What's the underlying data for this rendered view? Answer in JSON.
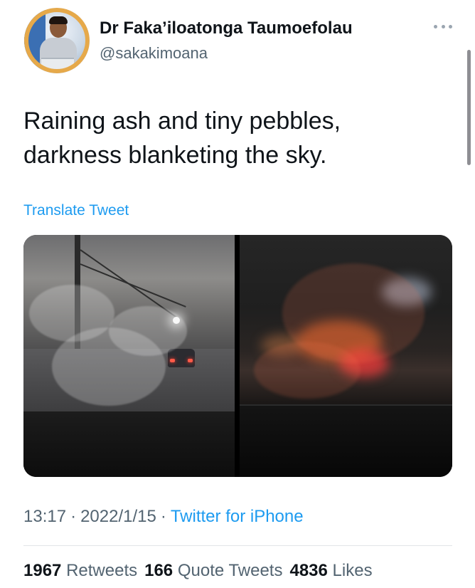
{
  "user": {
    "display_name": "Dr Faka’iloatonga Taumoefolau",
    "handle": "@sakakimoana"
  },
  "tweet": {
    "text_lines": [
      "Raining ash and tiny pebbles,",
      "darkness blanketing the sky."
    ],
    "translate_label": "Translate Tweet",
    "time": "13:17",
    "date": "2022/1/15",
    "separator": "·",
    "source": "Twitter for iPhone"
  },
  "stats": {
    "retweets_count": "1967",
    "retweets_label": "Retweets",
    "quotes_count": "166",
    "quotes_label": "Quote Tweets",
    "likes_count": "4836",
    "likes_label": "Likes"
  },
  "media": [
    {
      "kind": "photo",
      "subject": "rain-streaked windshield with car ahead"
    },
    {
      "kind": "photo",
      "subject": "blurred red tail lights through wet windshield at night"
    }
  ],
  "icons": [
    "more-options-icon"
  ],
  "colors": {
    "link": "#1d9bf0",
    "secondary_text": "#536471",
    "primary_text": "#0f1419"
  }
}
